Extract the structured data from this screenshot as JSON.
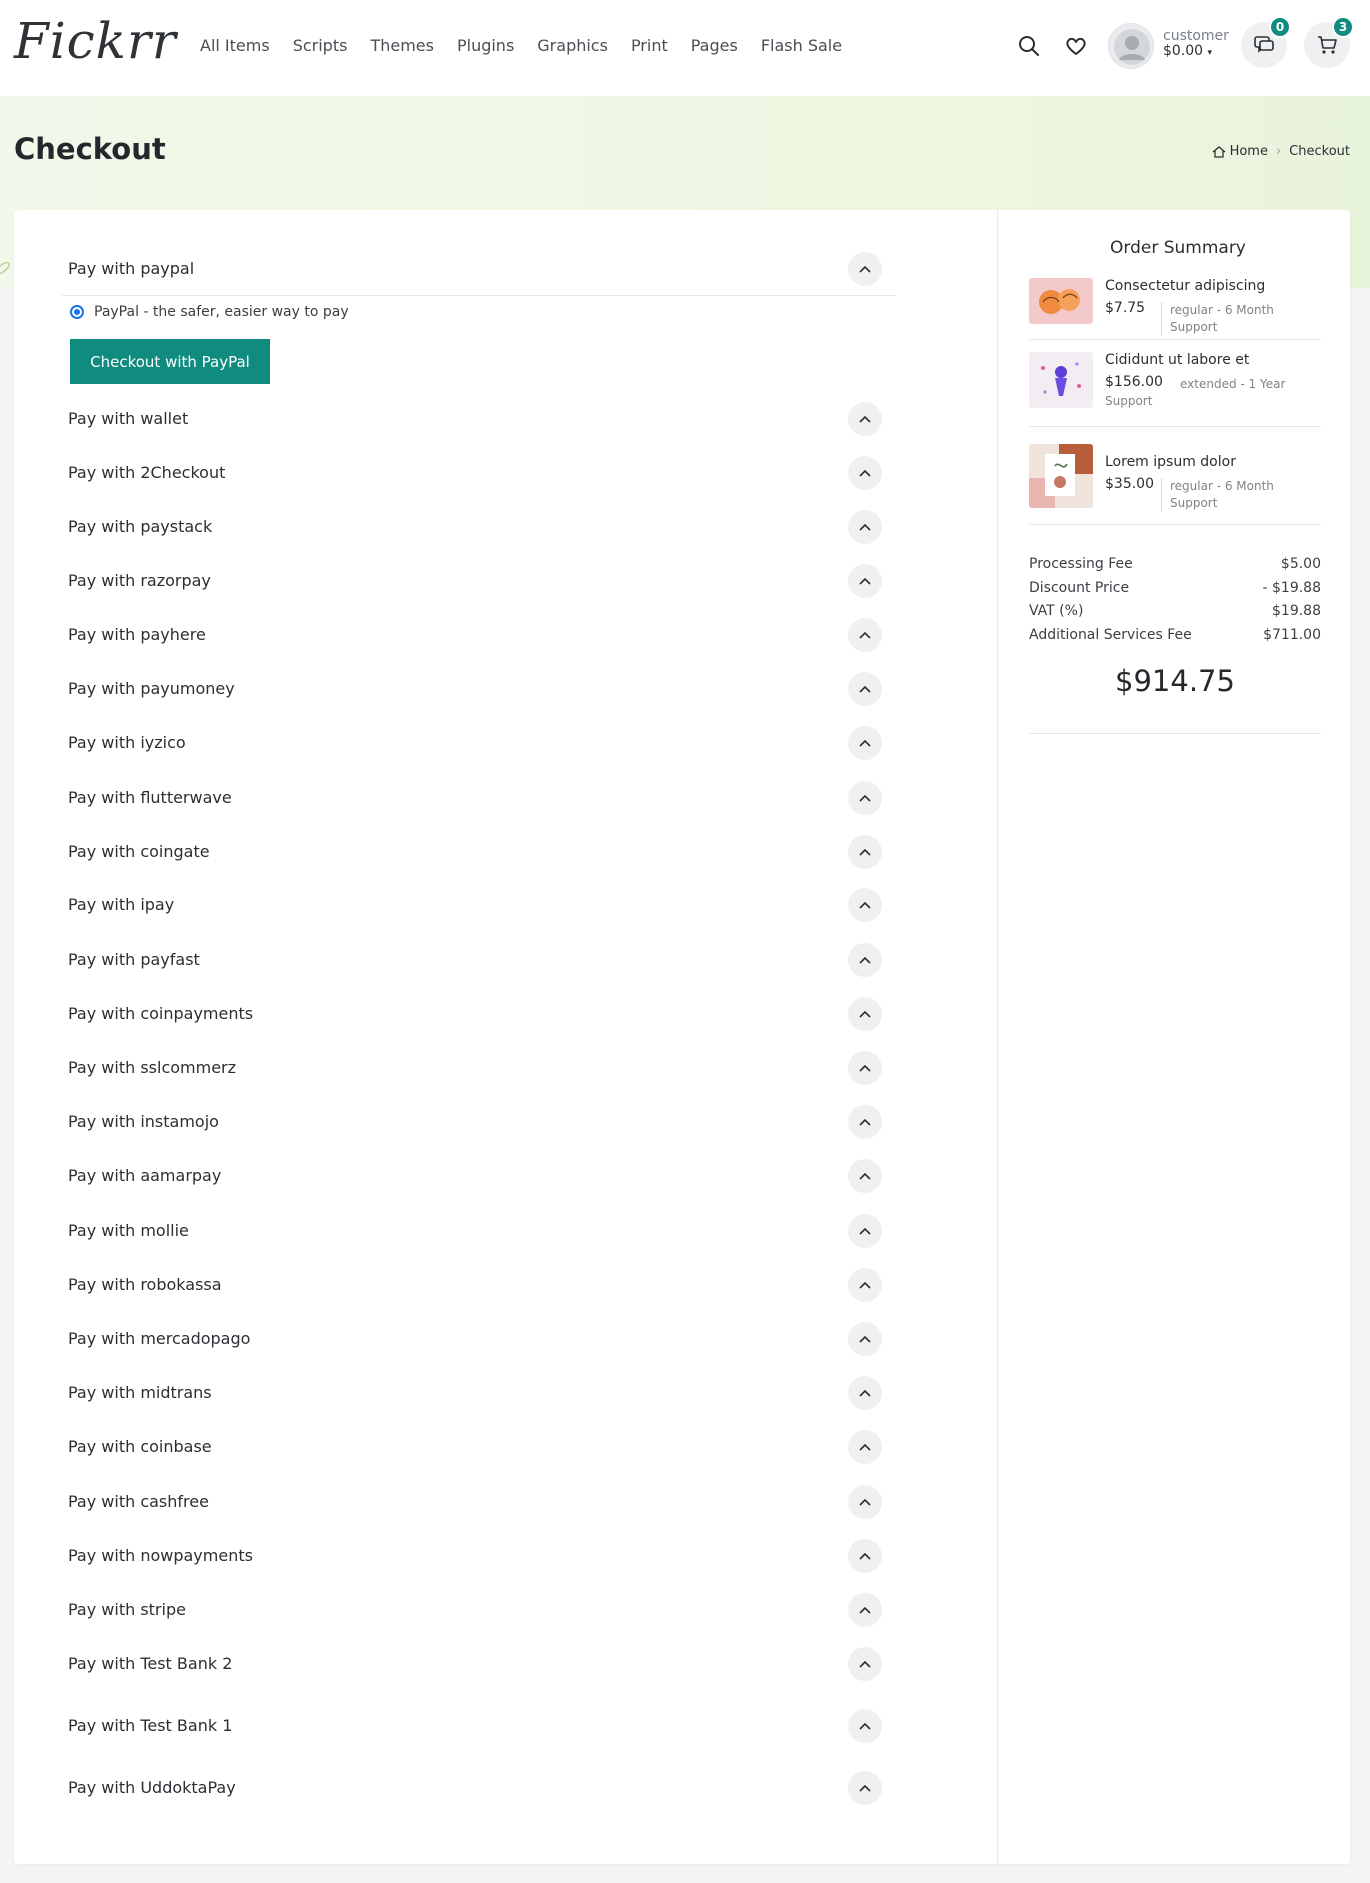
{
  "brand": {
    "logo": "Fickrr"
  },
  "nav": {
    "items": [
      "All Items",
      "Scripts",
      "Themes",
      "Plugins",
      "Graphics",
      "Print",
      "Pages",
      "Flash Sale"
    ]
  },
  "user": {
    "name": "customer",
    "balance": "$0.00"
  },
  "badges": {
    "messages": "0",
    "cart": "3"
  },
  "hero": {
    "title": "Checkout",
    "breadcrumb_home": "Home",
    "breadcrumb_current": "Checkout"
  },
  "payment": {
    "paypal_label": "Pay with paypal",
    "paypal_option": "PayPal - the safer, easier way to pay",
    "paypal_button": "Checkout with PayPal",
    "gateways": [
      "Pay with wallet",
      "Pay with 2Checkout",
      "Pay with paystack",
      "Pay with razorpay",
      "Pay with payhere",
      "Pay with payumoney",
      "Pay with iyzico",
      "Pay with flutterwave",
      "Pay with coingate",
      "Pay with ipay",
      "Pay with payfast",
      "Pay with coinpayments",
      "Pay with sslcommerz",
      "Pay with instamojo",
      "Pay with aamarpay",
      "Pay with mollie",
      "Pay with robokassa",
      "Pay with mercadopago",
      "Pay with midtrans",
      "Pay with coinbase",
      "Pay with cashfree",
      "Pay with nowpayments",
      "Pay with stripe",
      "Pay with Test Bank 2",
      "Pay with Test Bank 1",
      "Pay with UddoktaPay"
    ]
  },
  "summary": {
    "title": "Order Summary",
    "items": [
      {
        "name": "Consectetur adipiscing",
        "price": "$7.75",
        "meta": "regular - 6 Month Support"
      },
      {
        "name": "Cididunt ut labore et",
        "price": "$156.00",
        "meta": "extended - 1 Year Support"
      },
      {
        "name": "Lorem ipsum dolor",
        "price": "$35.00",
        "meta": "regular - 6 Month Support"
      }
    ],
    "fees": [
      {
        "label": "Processing Fee",
        "value": "$5.00"
      },
      {
        "label": "Discount Price",
        "value": "- $19.88"
      },
      {
        "label": "VAT (%)",
        "value": "$19.88"
      },
      {
        "label": "Additional Services Fee",
        "value": "$711.00"
      }
    ],
    "total": "$914.75"
  },
  "colors": {
    "accent": "#0f8b80",
    "radio": "#1a73e8"
  },
  "icons": [
    "search-icon",
    "heart-icon",
    "avatar-icon",
    "chat-icon",
    "cart-icon",
    "home-icon",
    "chevron-up-icon"
  ]
}
